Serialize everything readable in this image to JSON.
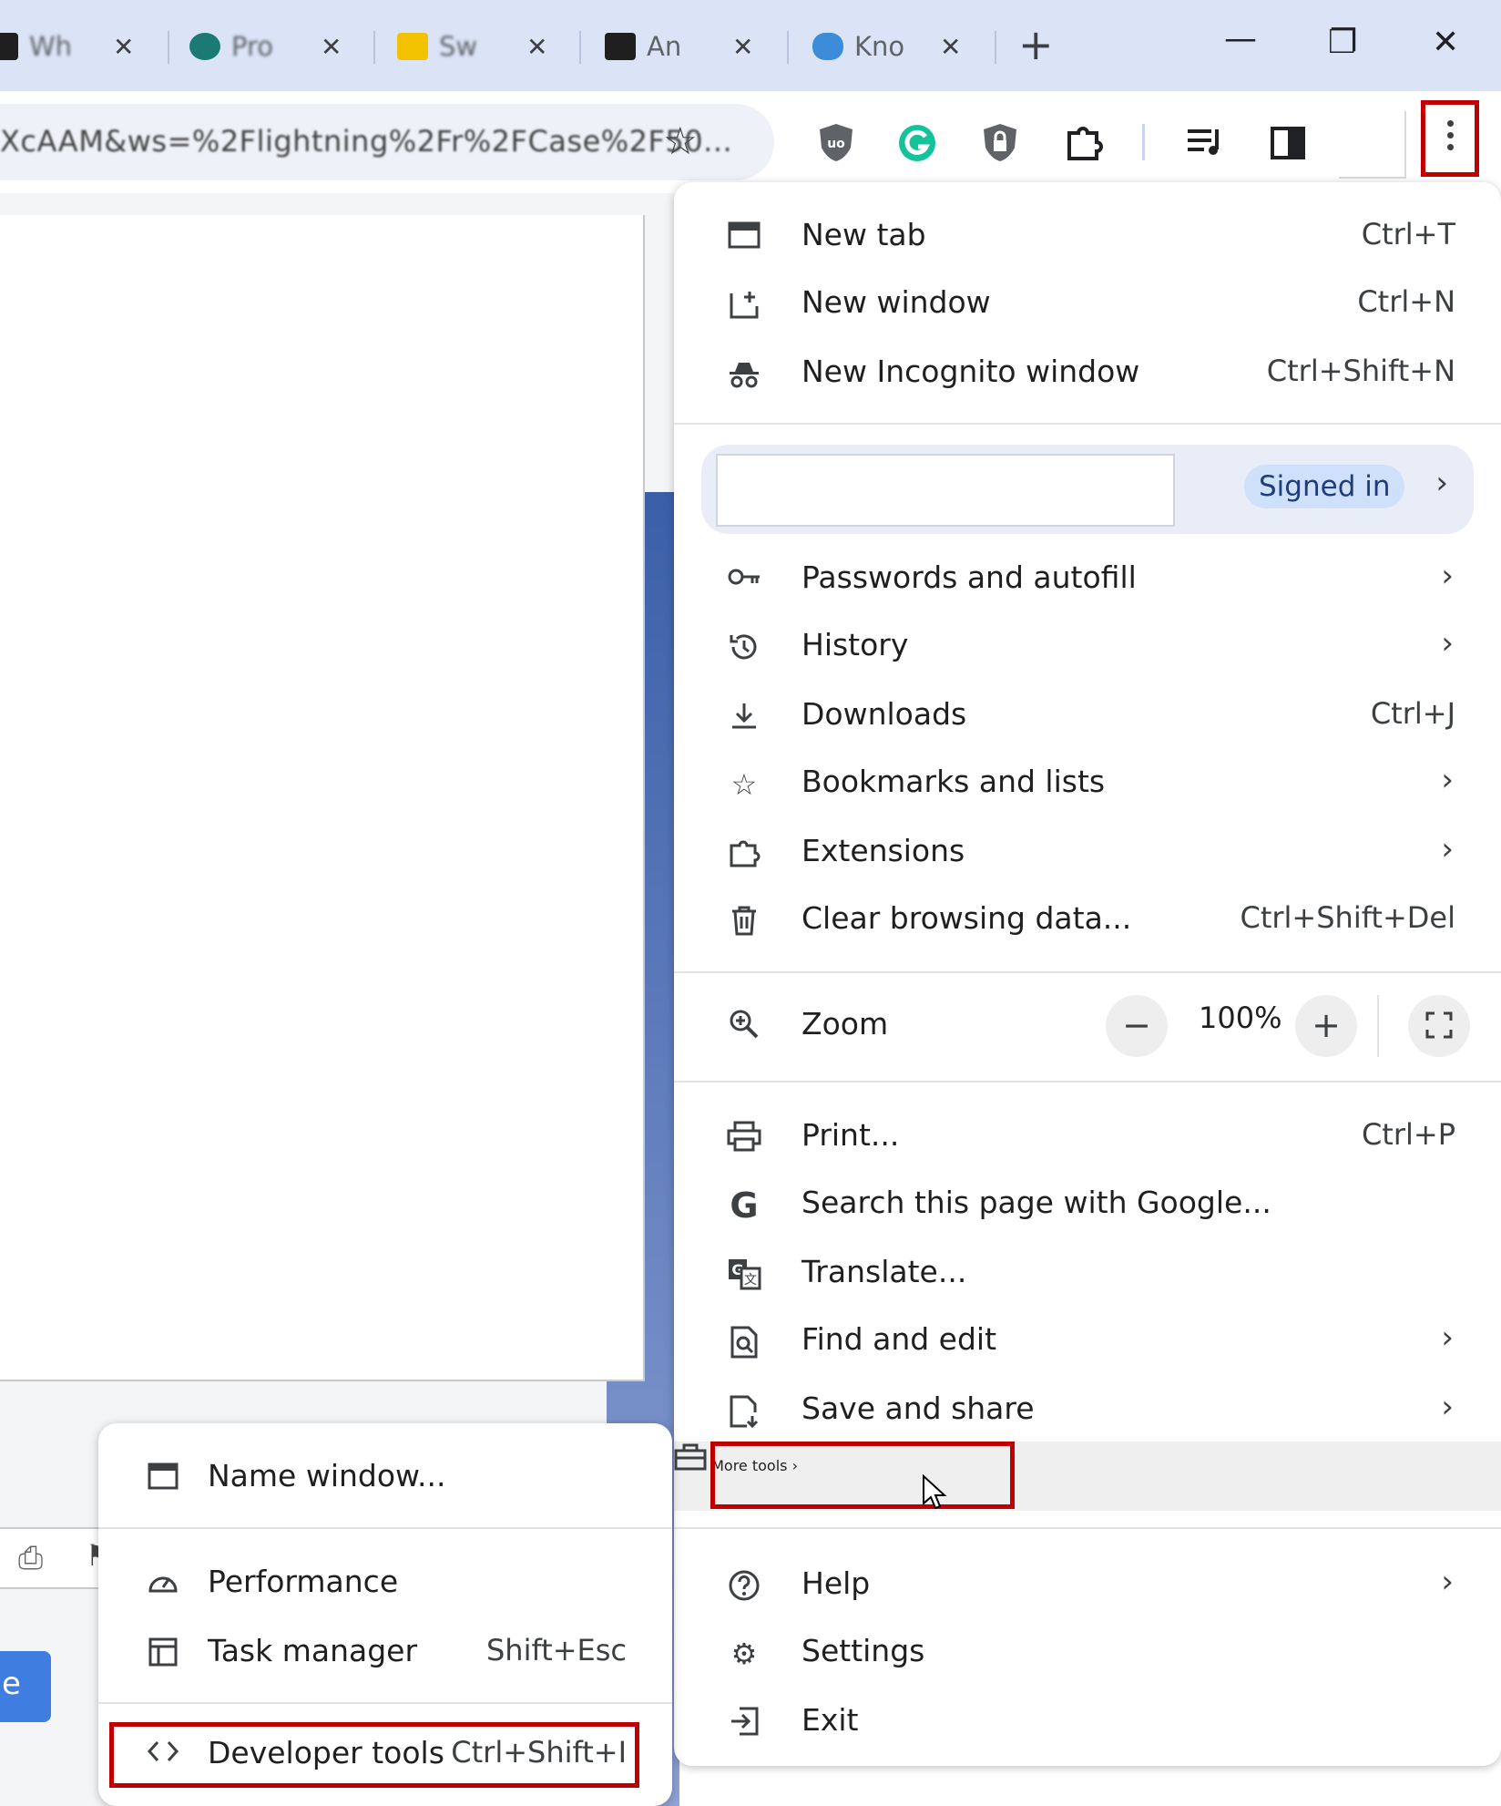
{
  "tabs": [
    {
      "label": "Wh",
      "color": "#1f1f1f"
    },
    {
      "label": "Pro",
      "color": "#1b7b74"
    },
    {
      "label": "Sw",
      "color": "#f2c200"
    },
    {
      "label": "An",
      "color": "#1f1f1f"
    },
    {
      "label": "Kno",
      "color": "#3c8cd9"
    }
  ],
  "tab_close": "✕",
  "new_tab_glyph": "+",
  "window_controls": {
    "minimize": "—",
    "restore": "❐",
    "close": "✕"
  },
  "toolbar": {
    "url": "XcAAM&ws=%2Flightning%2Fr%2FCase%2F50...",
    "bookmark_icon": "star-icon",
    "extensions": [
      "ublock-icon",
      "grammarly-icon",
      "shield-icon",
      "puzzle-icon",
      "media-icon",
      "side-panel-icon"
    ]
  },
  "page": {
    "button_text": "e"
  },
  "menu": {
    "new_tab": {
      "label": "New tab",
      "shortcut": "Ctrl+T"
    },
    "new_window": {
      "label": "New window",
      "shortcut": "Ctrl+N"
    },
    "new_incognito": {
      "label": "New Incognito window",
      "shortcut": "Ctrl+Shift+N"
    },
    "profile": {
      "status": "Signed in"
    },
    "passwords": {
      "label": "Passwords and autofill"
    },
    "history": {
      "label": "History"
    },
    "downloads": {
      "label": "Downloads",
      "shortcut": "Ctrl+J"
    },
    "bookmarks": {
      "label": "Bookmarks and lists"
    },
    "extensions": {
      "label": "Extensions"
    },
    "clear_data": {
      "label": "Clear browsing data...",
      "shortcut": "Ctrl+Shift+Del"
    },
    "zoom": {
      "label": "Zoom",
      "minus": "−",
      "value": "100%",
      "plus": "+"
    },
    "print": {
      "label": "Print...",
      "shortcut": "Ctrl+P"
    },
    "search_google": {
      "label": "Search this page with Google..."
    },
    "translate": {
      "label": "Translate..."
    },
    "find_edit": {
      "label": "Find and edit"
    },
    "save_share": {
      "label": "Save and share"
    },
    "more_tools": {
      "label": "More tools"
    },
    "help": {
      "label": "Help"
    },
    "settings": {
      "label": "Settings"
    },
    "exit": {
      "label": "Exit"
    },
    "chevron": "›"
  },
  "submenu": {
    "name_window": {
      "label": "Name window..."
    },
    "performance": {
      "label": "Performance"
    },
    "task_manager": {
      "label": "Task manager",
      "shortcut": "Shift+Esc"
    },
    "developer_tools": {
      "label": "Developer tools",
      "shortcut": "Ctrl+Shift+I"
    }
  },
  "colors": {
    "highlight_box": "#c00000",
    "tabstrip": "#dbe4f7",
    "chip": "#cfe0fb"
  }
}
